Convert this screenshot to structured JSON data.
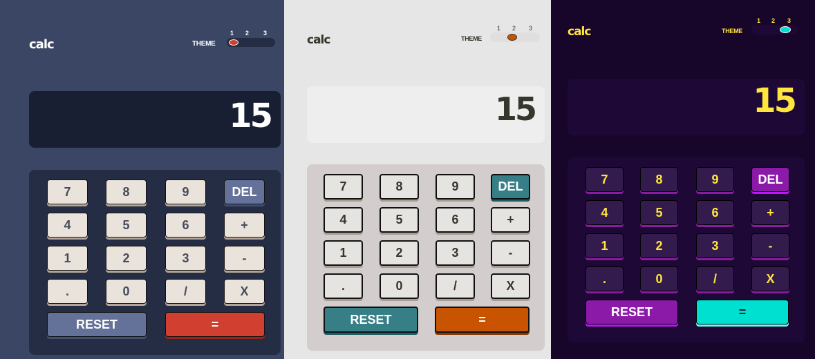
{
  "themes": [
    {
      "logo": "calc",
      "theme_label": "THEME",
      "theme_numbers": [
        "1",
        "2",
        "3"
      ],
      "selected_theme": 1,
      "display": "15",
      "keys": {
        "k7": "7",
        "k8": "8",
        "k9": "9",
        "del": "DEL",
        "k4": "4",
        "k5": "5",
        "k6": "6",
        "plus": "+",
        "k1": "1",
        "k2": "2",
        "k3": "3",
        "minus": "-",
        "dot": ".",
        "k0": "0",
        "div": "/",
        "mul": "X",
        "reset": "RESET",
        "eq": "="
      },
      "colors": {
        "background": "#3a4663",
        "accent": "#d03f2f",
        "key_face": "#eae3dc"
      }
    },
    {
      "logo": "calc",
      "theme_label": "THEME",
      "theme_numbers": [
        "1",
        "2",
        "3"
      ],
      "selected_theme": 2,
      "display": "15",
      "keys": {
        "k7": "7",
        "k8": "8",
        "k9": "9",
        "del": "DEL",
        "k4": "4",
        "k5": "5",
        "k6": "6",
        "plus": "+",
        "k1": "1",
        "k2": "2",
        "k3": "3",
        "minus": "-",
        "dot": ".",
        "k0": "0",
        "div": "/",
        "mul": "X",
        "reset": "RESET",
        "eq": "="
      },
      "colors": {
        "background": "#e6e6e6",
        "accent": "#c85402",
        "key_face": "#e5e4e1"
      }
    },
    {
      "logo": "calc",
      "theme_label": "THEME",
      "theme_numbers": [
        "1",
        "2",
        "3"
      ],
      "selected_theme": 3,
      "display": "15",
      "keys": {
        "k7": "7",
        "k8": "8",
        "k9": "9",
        "del": "DEL",
        "k4": "4",
        "k5": "5",
        "k6": "6",
        "plus": "+",
        "k1": "1",
        "k2": "2",
        "k3": "3",
        "minus": "-",
        "dot": ".",
        "k0": "0",
        "div": "/",
        "mul": "X",
        "reset": "RESET",
        "eq": "="
      },
      "colors": {
        "background": "#17062a",
        "accent": "#00e0d1",
        "key_face": "#331c4d"
      }
    }
  ]
}
